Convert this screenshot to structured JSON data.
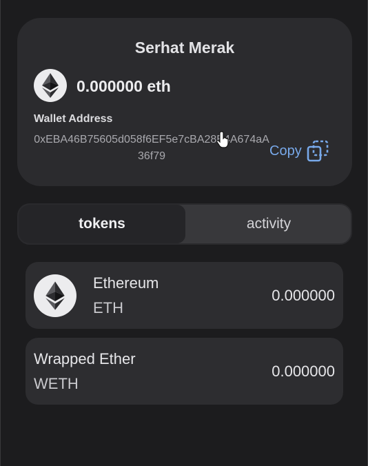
{
  "wallet": {
    "name": "Serhat Merak",
    "balance": "0.000000 eth",
    "address_label": "Wallet Address",
    "address": "0xEBA46B75605d058f6EF5e7cBA28E4A674aA36f79",
    "copy_label": "Copy",
    "icon": "ethereum-icon"
  },
  "tabs": [
    {
      "label": "tokens",
      "active": true
    },
    {
      "label": "activity",
      "active": false
    }
  ],
  "tokens": [
    {
      "name": "Ethereum",
      "symbol": "ETH",
      "amount": "0.000000",
      "icon": "ethereum-icon"
    },
    {
      "name": "Wrapped Ether",
      "symbol": "WETH",
      "amount": "0.000000"
    }
  ],
  "colors": {
    "background": "#1c1c1e",
    "card": "#2b2b2e",
    "accent": "#78a9ea"
  }
}
